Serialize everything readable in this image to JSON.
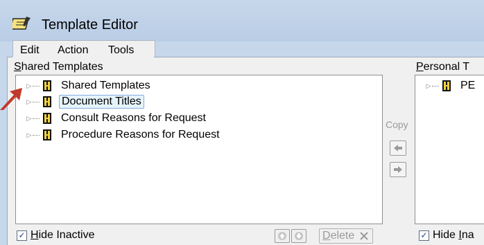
{
  "window": {
    "title": "Template Editor",
    "icon": "notepad-icon"
  },
  "menu": {
    "items": [
      "Edit",
      "Action",
      "Tools"
    ]
  },
  "shared": {
    "label_first": "S",
    "label_rest": "hared Templates",
    "items": [
      {
        "label": "Shared Templates",
        "selected": false
      },
      {
        "label": "Document Titles",
        "selected": true
      },
      {
        "label": "Consult Reasons for Request",
        "selected": false
      },
      {
        "label": "Procedure Reasons for Request",
        "selected": false
      }
    ],
    "hide_inactive": {
      "first": "H",
      "rest": "ide Inactive",
      "checked": true
    },
    "delete_label_first": "D",
    "delete_label_rest": "elete"
  },
  "copy": {
    "label": "Copy"
  },
  "personal": {
    "label_first": "P",
    "label_rest": "ersonal T",
    "items": [
      {
        "label": "PE"
      }
    ],
    "hide_inactive": {
      "first": "Hide ",
      "u": "I",
      "rest": "na",
      "checked": true
    }
  },
  "colors": {
    "title_bg": "#c7d7ea",
    "pane_bg": "#f0f0f0",
    "selection_border": "#84acdd",
    "annotation_arrow": "#c0392b"
  }
}
